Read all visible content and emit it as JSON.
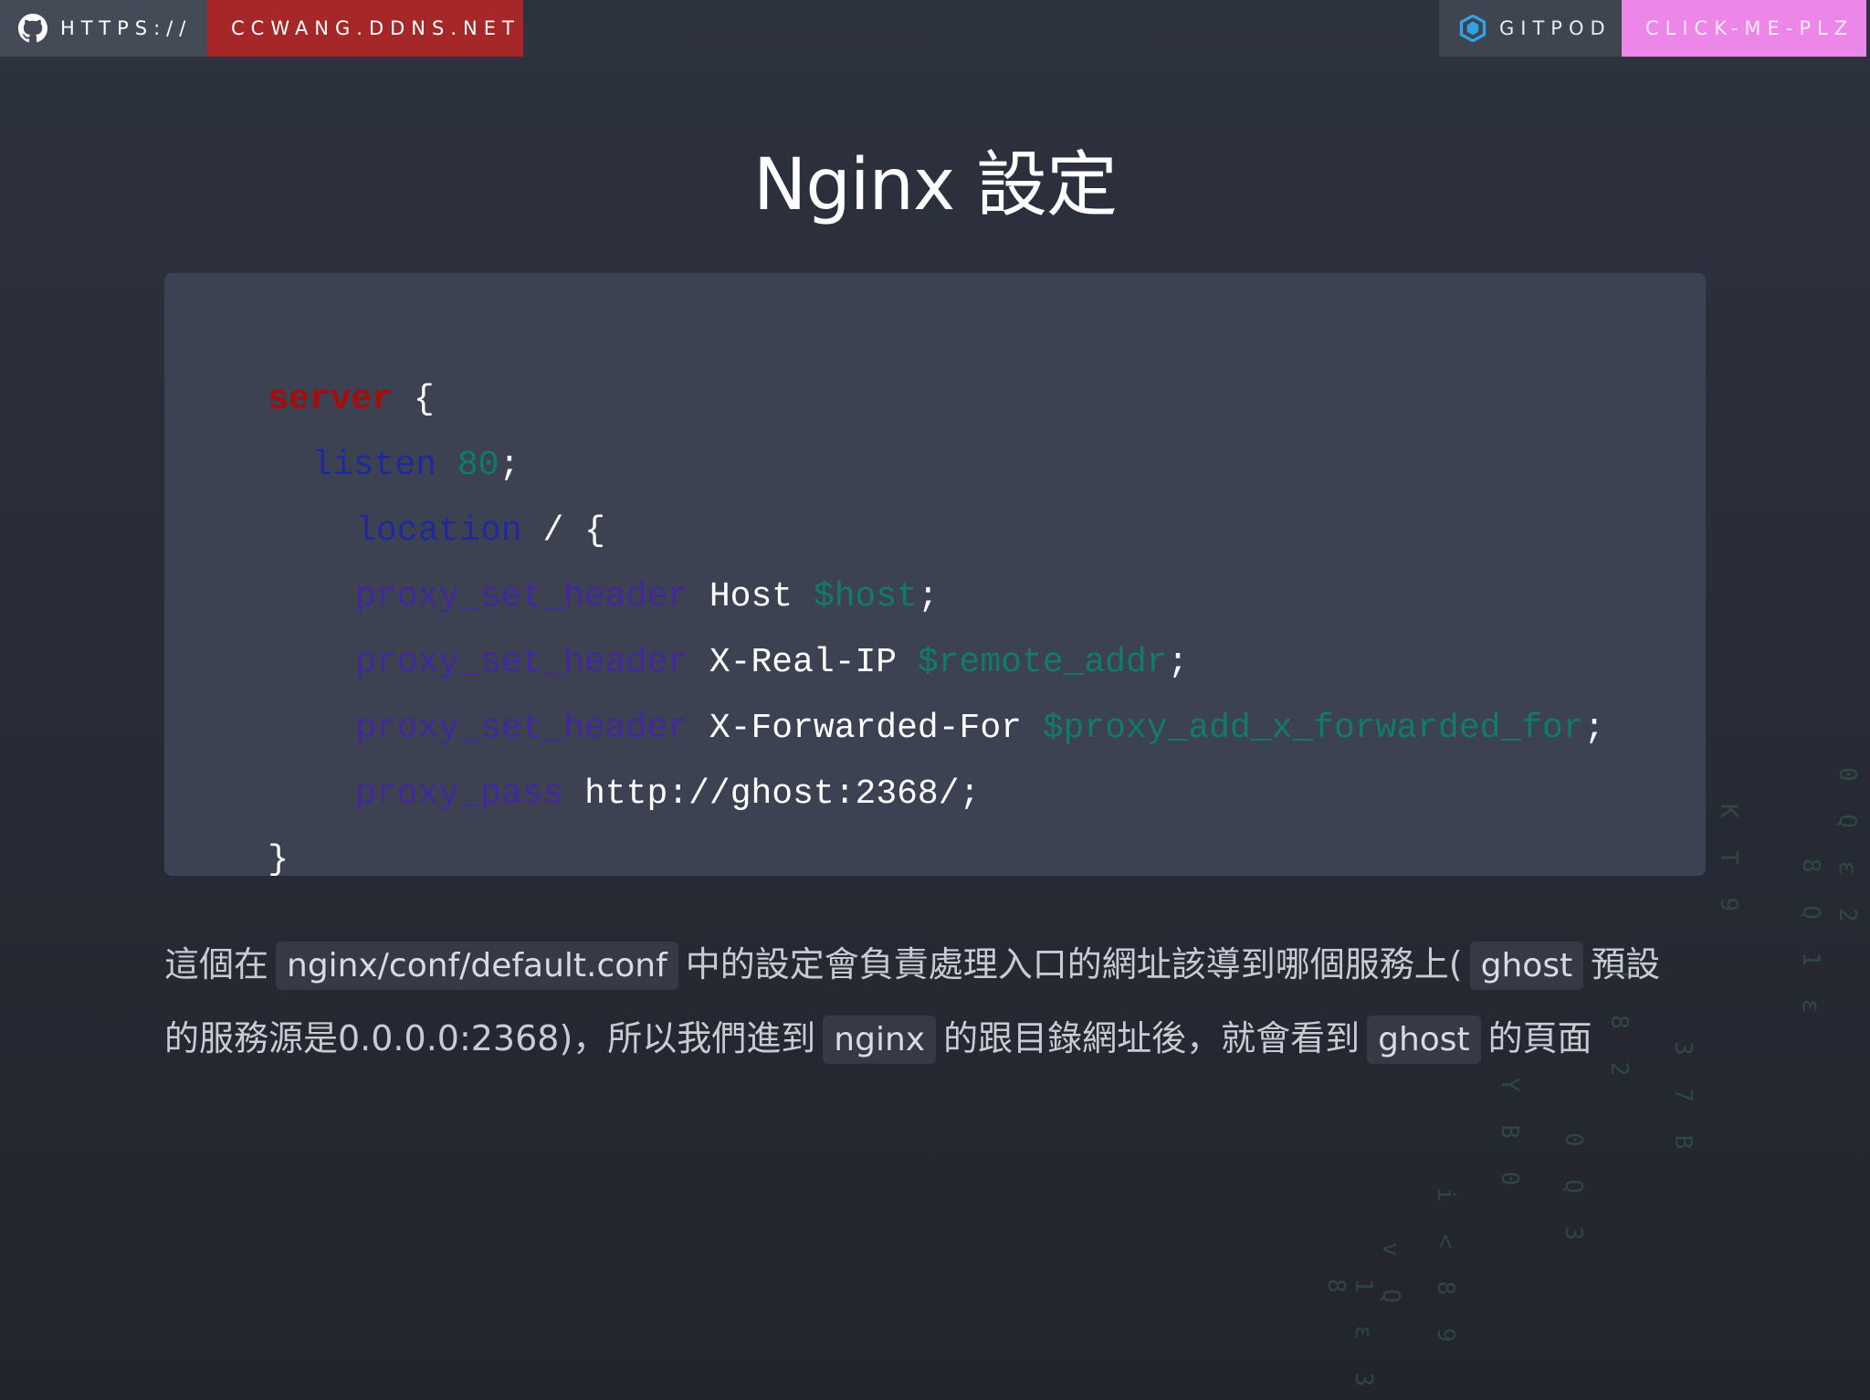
{
  "badges": {
    "github": {
      "left_label": "HTTPS://",
      "right_label": "CCWANG.DDNS.NET",
      "icon": "github-icon",
      "left_color": "#454b56",
      "right_color": "#a52728"
    },
    "gitpod": {
      "left_label": "GITPOD",
      "right_label": "CLICK-ME-PLZ",
      "icon": "gitpod-icon",
      "left_color": "#3e4450",
      "right_color": "#ec86e8"
    }
  },
  "slide": {
    "title": "Nginx 設定"
  },
  "code": {
    "background": "#3c4252",
    "lines": [
      {
        "indent": "",
        "parts": [
          "server",
          " {"
        ]
      },
      {
        "indent": "  ",
        "parts": [
          "listen",
          " ",
          "80",
          ";"
        ]
      },
      {
        "indent": "    ",
        "parts": [
          "location",
          " / {"
        ]
      },
      {
        "indent": "    ",
        "parts": [
          "proxy_set_header",
          " Host ",
          "$host",
          ";"
        ]
      },
      {
        "indent": "    ",
        "parts": [
          "proxy_set_header",
          " X-Real-IP ",
          "$remote_addr",
          ";"
        ]
      },
      {
        "indent": "    ",
        "parts": [
          "proxy_set_header",
          " X-Forwarded-For ",
          "$proxy_add_x_forwarded_for",
          ";"
        ]
      },
      {
        "indent": "    ",
        "parts": [
          "proxy_pass",
          " http://ghost:2368/;"
        ]
      },
      {
        "indent": "",
        "parts": [
          "}"
        ]
      }
    ]
  },
  "description": {
    "line1": {
      "t1": "這個在",
      "c1": "nginx/conf/default.conf",
      "t2": "中的設定會負責處理入口的網址該導到哪個服務上(",
      "c2": "ghost",
      "t3": "預設"
    },
    "line2": {
      "t1": "的服務源是0.0.0.0:2368)，所以我們進到",
      "c1": "nginx",
      "t2": "的跟目錄網址後，就會看到",
      "c2": "ghost",
      "t3": "的頁面"
    }
  },
  "matrix_glyphs": [
    "0 Q ε 2",
    "8 Q 1 ε",
    "K T 9",
    "3 7 B",
    "[ 8 2",
    "0 Q 3",
    "Y B 0",
    "i < 8 9",
    "v Q",
    "1 ε 3 8"
  ]
}
